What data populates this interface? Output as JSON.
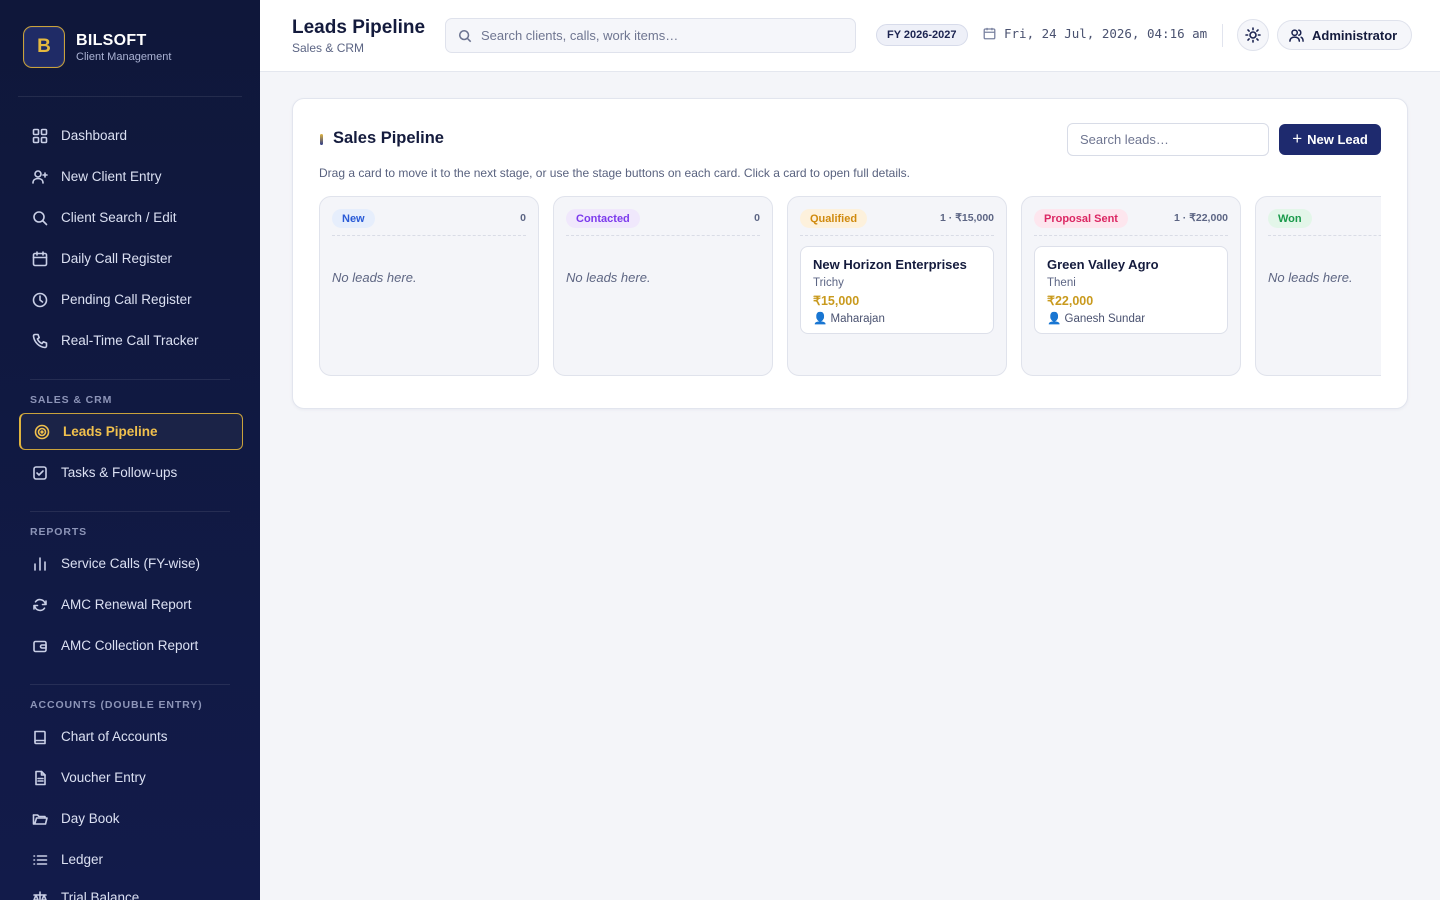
{
  "brand": {
    "logo_letter": "B",
    "name": "BILSOFT",
    "subtitle": "Client Management"
  },
  "sidebar": {
    "main_items": [
      {
        "label": "Dashboard",
        "icon": "grid-icon"
      },
      {
        "label": "New Client Entry",
        "icon": "user-plus-icon"
      },
      {
        "label": "Client Search / Edit",
        "icon": "search-icon"
      },
      {
        "label": "Daily Call Register",
        "icon": "calendar-icon"
      },
      {
        "label": "Pending Call Register",
        "icon": "clock-icon"
      },
      {
        "label": "Real-Time Call Tracker",
        "icon": "phone-icon"
      }
    ],
    "sales_title": "SALES & CRM",
    "sales_items": [
      {
        "label": "Leads Pipeline",
        "icon": "target-icon",
        "active": true
      },
      {
        "label": "Tasks & Follow-ups",
        "icon": "checkbox-icon"
      }
    ],
    "reports_title": "REPORTS",
    "reports_items": [
      {
        "label": "Service Calls (FY-wise)",
        "icon": "bar-chart-icon"
      },
      {
        "label": "AMC Renewal Report",
        "icon": "refresh-icon"
      },
      {
        "label": "AMC Collection Report",
        "icon": "wallet-icon"
      }
    ],
    "accounts_title": "ACCOUNTS (DOUBLE ENTRY)",
    "accounts_items": [
      {
        "label": "Chart of Accounts",
        "icon": "book-icon"
      },
      {
        "label": "Voucher Entry",
        "icon": "file-text-icon"
      },
      {
        "label": "Day Book",
        "icon": "folder-open-icon"
      },
      {
        "label": "Ledger",
        "icon": "list-icon"
      },
      {
        "label": "Trial Balance",
        "icon": "scale-icon"
      }
    ]
  },
  "header": {
    "title": "Leads Pipeline",
    "subtitle": "Sales & CRM",
    "search_placeholder": "Search clients, calls, work items…",
    "fy": "FY 2026-2027",
    "datetime": "Fri, 24 Jul, 2026, 04:16 am",
    "user": "Administrator"
  },
  "pipeline": {
    "title": "Sales Pipeline",
    "search_placeholder": "Search leads…",
    "new_lead_label": "New Lead",
    "help": "Drag a card to move it to the next stage, or use the stage buttons on each card. Click a card to open full details.",
    "empty_text": "No leads here.",
    "colors": {
      "new": {
        "bg": "#e6eefc",
        "fg": "#2a5bd7"
      },
      "contacted": {
        "bg": "#f0e8fc",
        "fg": "#7c3aed"
      },
      "qualified": {
        "bg": "#fdf1dc",
        "fg": "#d08a0e"
      },
      "proposal": {
        "bg": "#fde6ee",
        "fg": "#db2763"
      },
      "won": {
        "bg": "#e3f6e9",
        "fg": "#1a9a4b"
      }
    },
    "columns": [
      {
        "stage": "New",
        "count": "0",
        "leads": []
      },
      {
        "stage": "Contacted",
        "count": "0",
        "leads": []
      },
      {
        "stage": "Qualified",
        "count": "1 · ₹15,000",
        "leads": [
          {
            "name": "New Horizon Enterprises",
            "city": "Trichy",
            "amount": "₹15,000",
            "owner": "👤 Maharajan"
          }
        ]
      },
      {
        "stage": "Proposal Sent",
        "count": "1 · ₹22,000",
        "leads": [
          {
            "name": "Green Valley Agro",
            "city": "Theni",
            "amount": "₹22,000",
            "owner": "👤 Ganesh Sundar"
          }
        ]
      },
      {
        "stage": "Won",
        "count": "",
        "leads": []
      }
    ]
  }
}
